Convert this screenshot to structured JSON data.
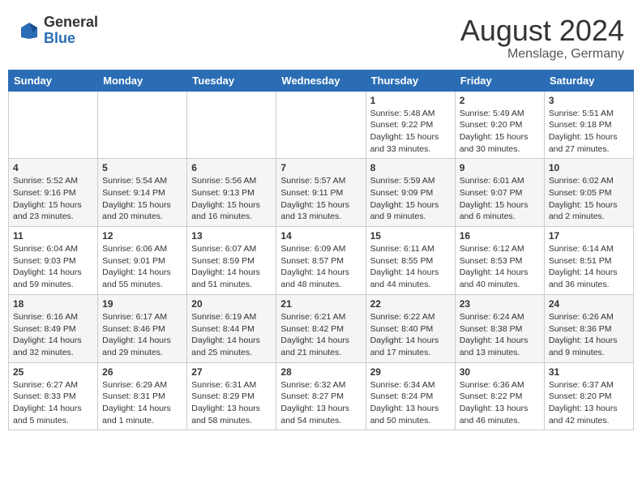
{
  "header": {
    "logo_general": "General",
    "logo_blue": "Blue",
    "month_year": "August 2024",
    "location": "Menslage, Germany"
  },
  "weekdays": [
    "Sunday",
    "Monday",
    "Tuesday",
    "Wednesday",
    "Thursday",
    "Friday",
    "Saturday"
  ],
  "weeks": [
    [
      {
        "day": "",
        "info": ""
      },
      {
        "day": "",
        "info": ""
      },
      {
        "day": "",
        "info": ""
      },
      {
        "day": "",
        "info": ""
      },
      {
        "day": "1",
        "info": "Sunrise: 5:48 AM\nSunset: 9:22 PM\nDaylight: 15 hours\nand 33 minutes."
      },
      {
        "day": "2",
        "info": "Sunrise: 5:49 AM\nSunset: 9:20 PM\nDaylight: 15 hours\nand 30 minutes."
      },
      {
        "day": "3",
        "info": "Sunrise: 5:51 AM\nSunset: 9:18 PM\nDaylight: 15 hours\nand 27 minutes."
      }
    ],
    [
      {
        "day": "4",
        "info": "Sunrise: 5:52 AM\nSunset: 9:16 PM\nDaylight: 15 hours\nand 23 minutes."
      },
      {
        "day": "5",
        "info": "Sunrise: 5:54 AM\nSunset: 9:14 PM\nDaylight: 15 hours\nand 20 minutes."
      },
      {
        "day": "6",
        "info": "Sunrise: 5:56 AM\nSunset: 9:13 PM\nDaylight: 15 hours\nand 16 minutes."
      },
      {
        "day": "7",
        "info": "Sunrise: 5:57 AM\nSunset: 9:11 PM\nDaylight: 15 hours\nand 13 minutes."
      },
      {
        "day": "8",
        "info": "Sunrise: 5:59 AM\nSunset: 9:09 PM\nDaylight: 15 hours\nand 9 minutes."
      },
      {
        "day": "9",
        "info": "Sunrise: 6:01 AM\nSunset: 9:07 PM\nDaylight: 15 hours\nand 6 minutes."
      },
      {
        "day": "10",
        "info": "Sunrise: 6:02 AM\nSunset: 9:05 PM\nDaylight: 15 hours\nand 2 minutes."
      }
    ],
    [
      {
        "day": "11",
        "info": "Sunrise: 6:04 AM\nSunset: 9:03 PM\nDaylight: 14 hours\nand 59 minutes."
      },
      {
        "day": "12",
        "info": "Sunrise: 6:06 AM\nSunset: 9:01 PM\nDaylight: 14 hours\nand 55 minutes."
      },
      {
        "day": "13",
        "info": "Sunrise: 6:07 AM\nSunset: 8:59 PM\nDaylight: 14 hours\nand 51 minutes."
      },
      {
        "day": "14",
        "info": "Sunrise: 6:09 AM\nSunset: 8:57 PM\nDaylight: 14 hours\nand 48 minutes."
      },
      {
        "day": "15",
        "info": "Sunrise: 6:11 AM\nSunset: 8:55 PM\nDaylight: 14 hours\nand 44 minutes."
      },
      {
        "day": "16",
        "info": "Sunrise: 6:12 AM\nSunset: 8:53 PM\nDaylight: 14 hours\nand 40 minutes."
      },
      {
        "day": "17",
        "info": "Sunrise: 6:14 AM\nSunset: 8:51 PM\nDaylight: 14 hours\nand 36 minutes."
      }
    ],
    [
      {
        "day": "18",
        "info": "Sunrise: 6:16 AM\nSunset: 8:49 PM\nDaylight: 14 hours\nand 32 minutes."
      },
      {
        "day": "19",
        "info": "Sunrise: 6:17 AM\nSunset: 8:46 PM\nDaylight: 14 hours\nand 29 minutes."
      },
      {
        "day": "20",
        "info": "Sunrise: 6:19 AM\nSunset: 8:44 PM\nDaylight: 14 hours\nand 25 minutes."
      },
      {
        "day": "21",
        "info": "Sunrise: 6:21 AM\nSunset: 8:42 PM\nDaylight: 14 hours\nand 21 minutes."
      },
      {
        "day": "22",
        "info": "Sunrise: 6:22 AM\nSunset: 8:40 PM\nDaylight: 14 hours\nand 17 minutes."
      },
      {
        "day": "23",
        "info": "Sunrise: 6:24 AM\nSunset: 8:38 PM\nDaylight: 14 hours\nand 13 minutes."
      },
      {
        "day": "24",
        "info": "Sunrise: 6:26 AM\nSunset: 8:36 PM\nDaylight: 14 hours\nand 9 minutes."
      }
    ],
    [
      {
        "day": "25",
        "info": "Sunrise: 6:27 AM\nSunset: 8:33 PM\nDaylight: 14 hours\nand 5 minutes."
      },
      {
        "day": "26",
        "info": "Sunrise: 6:29 AM\nSunset: 8:31 PM\nDaylight: 14 hours\nand 1 minute."
      },
      {
        "day": "27",
        "info": "Sunrise: 6:31 AM\nSunset: 8:29 PM\nDaylight: 13 hours\nand 58 minutes."
      },
      {
        "day": "28",
        "info": "Sunrise: 6:32 AM\nSunset: 8:27 PM\nDaylight: 13 hours\nand 54 minutes."
      },
      {
        "day": "29",
        "info": "Sunrise: 6:34 AM\nSunset: 8:24 PM\nDaylight: 13 hours\nand 50 minutes."
      },
      {
        "day": "30",
        "info": "Sunrise: 6:36 AM\nSunset: 8:22 PM\nDaylight: 13 hours\nand 46 minutes."
      },
      {
        "day": "31",
        "info": "Sunrise: 6:37 AM\nSunset: 8:20 PM\nDaylight: 13 hours\nand 42 minutes."
      }
    ]
  ]
}
